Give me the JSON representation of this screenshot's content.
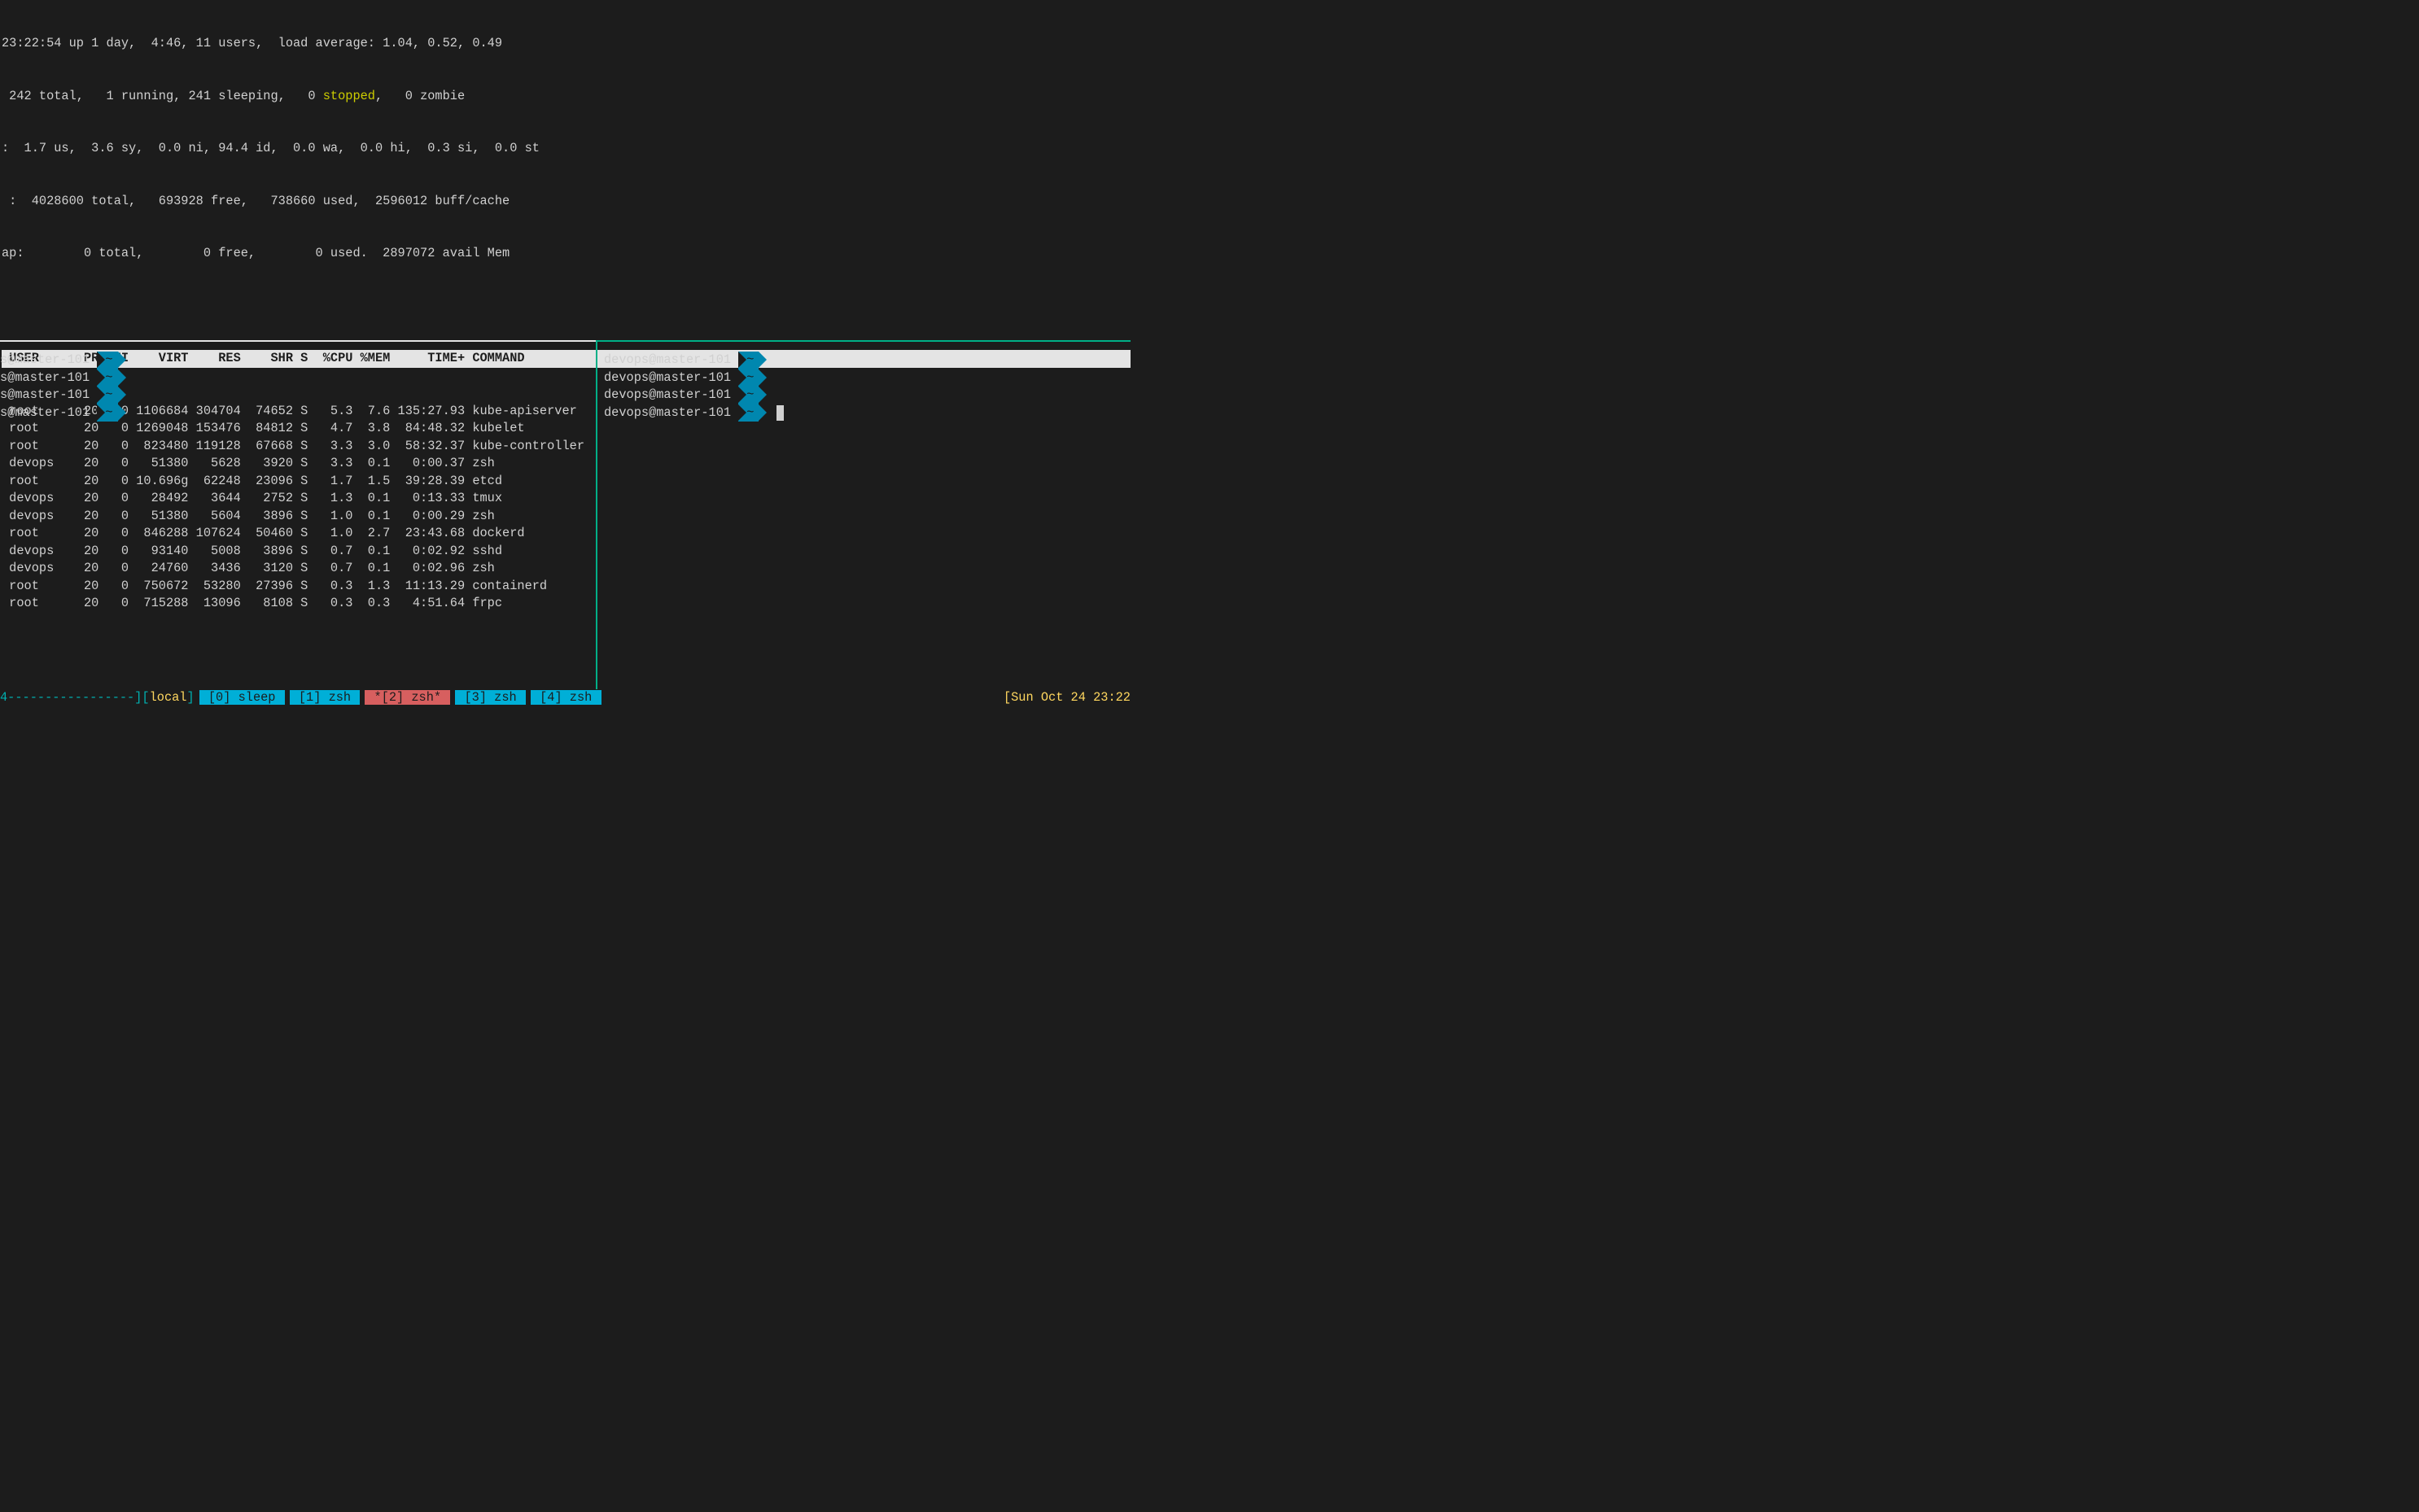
{
  "top_summary": {
    "line1_a": "23:22:54 up 1 day,  4:46, 11 users,  load average: 1.04, 0.52, 0.49",
    "line2_a": " 242 total,   1 running, 241 sleeping,   0 ",
    "line2_stopped": "stopped",
    "line2_b": ",   0 zombie",
    "line3": ":  1.7 us,  3.6 sy,  0.0 ni, 94.4 id,  0.0 wa,  0.0 hi,  0.3 si,  0.0 st",
    "line4": " :  4028600 total,   693928 free,   738660 used,  2596012 buff/cache",
    "line5": "ap:        0 total,        0 free,        0 used.  2897072 avail Mem"
  },
  "top_header": " USER      PR  NI    VIRT    RES    SHR S  %CPU %MEM     TIME+ COMMAND                                                                                                                 ",
  "processes": [
    " root      20   0 1106684 304704  74652 S   5.3  7.6 135:27.93 kube-apiserver",
    " root      20   0 1269048 153476  84812 S   4.7  3.8  84:48.32 kubelet",
    " root      20   0  823480 119128  67668 S   3.3  3.0  58:32.37 kube-controller",
    " devops    20   0   51380   5628   3920 S   3.3  0.1   0:00.37 zsh",
    " root      20   0 10.696g  62248  23096 S   1.7  1.5  39:28.39 etcd",
    " devops    20   0   28492   3644   2752 S   1.3  0.1   0:13.33 tmux",
    " devops    20   0   51380   5604   3896 S   1.0  0.1   0:00.29 zsh",
    " root      20   0  846288 107624  50460 S   1.0  2.7  23:43.68 dockerd",
    " devops    20   0   93140   5008   3896 S   0.7  0.1   0:02.92 sshd",
    " devops    20   0   24760   3436   3120 S   0.7  0.1   0:02.96 zsh",
    " root      20   0  750672  53280  27396 S   0.3  1.3  11:13.29 containerd",
    " root      20   0  715288  13096   8108 S   0.3  0.3   4:51.64 frpc"
  ],
  "prompt_left": [
    "s@master-101 ",
    "s@master-101 ",
    "s@master-101 ",
    "s@master-101 "
  ],
  "prompt_right": [
    "devops@master-101 ",
    "devops@master-101 ",
    "devops@master-101 ",
    "devops@master-101 "
  ],
  "prompt_tilde": "~",
  "status": {
    "dashes": "4-----------------",
    "br_open": "][",
    "local": "local",
    "br_close": "]",
    "windows": [
      {
        "label": "[0] sleep",
        "class": "bg-cyan"
      },
      {
        "label": "[1] zsh",
        "class": "bg-cyan"
      },
      {
        "label": "*[2] zsh*",
        "class": "bg-red"
      },
      {
        "label": "[3] zsh",
        "class": "bg-cyan"
      },
      {
        "label": "[4] zsh",
        "class": "bg-cyan"
      }
    ],
    "clock": "[Sun Oct 24 23:22"
  }
}
